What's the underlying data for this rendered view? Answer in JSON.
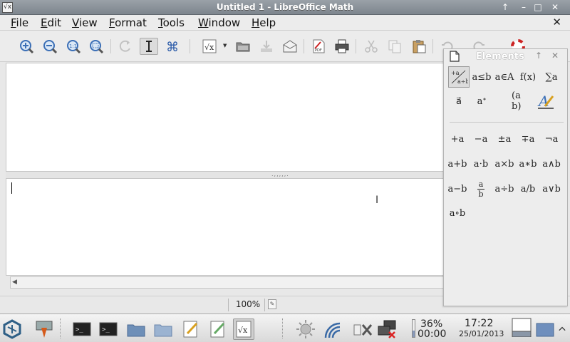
{
  "window": {
    "title": "Untitled 1 - LibreOffice Math",
    "app_icon_glyph": "√x",
    "controls": [
      "↑",
      "–",
      "□",
      "✕"
    ]
  },
  "menubar": {
    "items": [
      {
        "label": "File",
        "mnemonic": "F",
        "rest": "ile"
      },
      {
        "label": "Edit",
        "mnemonic": "E",
        "rest": "dit"
      },
      {
        "label": "View",
        "mnemonic": "V",
        "rest": "iew"
      },
      {
        "label": "Format",
        "mnemonic": "F",
        "rest": "ormat"
      },
      {
        "label": "Tools",
        "mnemonic": "T",
        "rest": "ools"
      },
      {
        "label": "Window",
        "mnemonic": "W",
        "rest": "indow"
      },
      {
        "label": "Help",
        "mnemonic": "H",
        "rest": "elp"
      }
    ],
    "close_glyph": "✕"
  },
  "toolbar": {
    "icons": [
      "zoom-in-icon",
      "zoom-out-icon",
      "zoom-100-icon",
      "show-all-icon",
      "update-icon",
      "formula-cursor-icon",
      "symbols-icon",
      "insert-formula-icon",
      "open-icon",
      "save-icon",
      "email-icon",
      "export-pdf-icon",
      "print-icon",
      "cut-icon",
      "copy-icon",
      "paste-icon",
      "undo-icon",
      "redo-icon",
      "help-icon"
    ]
  },
  "splitter_grip": ".,,,,,.",
  "statusbar": {
    "zoom": "100%"
  },
  "elements_panel": {
    "title": "Elements",
    "categories_row1": [
      "+a/a÷b",
      "a≤b",
      "a∈A",
      "f(x)",
      "∑a"
    ],
    "categories_row2": [
      "a⃗",
      "aᐩ",
      "(a b)",
      "A-style"
    ],
    "unary": [
      "+a",
      "−a",
      "±a",
      "∓a",
      "¬a"
    ],
    "binary1": [
      "a+b",
      "a⋅b",
      "a×b",
      "a∗b",
      "a∧b"
    ],
    "binary2_pre": "a−b",
    "frac": {
      "num": "a",
      "den": "b"
    },
    "binary2_post": [
      "a÷b",
      "a/b",
      "a∨b"
    ],
    "binary3": [
      "a∘b"
    ]
  },
  "taskbar": {
    "battery": {
      "percent": "36%",
      "time_left": "00:00",
      "level": 0.36
    },
    "clock": {
      "time": "17:22",
      "date": "25/01/2013"
    }
  },
  "colors": {
    "titlebar": "#8a9299",
    "accent_blue": "#3b6fb6"
  }
}
